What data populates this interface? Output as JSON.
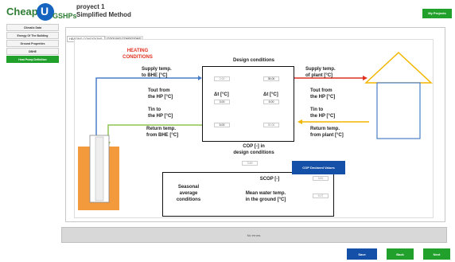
{
  "header": {
    "logo_text_left": "Cheap",
    "logo_text_right": "GSHPs",
    "project_name": "proyect 1",
    "method": "Simplified Method",
    "my_projects": "My Projects"
  },
  "sidebar": {
    "items": [
      {
        "label": "Climatic Data"
      },
      {
        "label": "Energy Of The Building"
      },
      {
        "label": "Ground Properties"
      },
      {
        "label": "DBHE"
      },
      {
        "label": "Heat Pump Definition"
      }
    ]
  },
  "tabs": [
    {
      "label": "HEATING CONDITIONS"
    },
    {
      "label": "COOLING CONDITIONS"
    }
  ],
  "diagram": {
    "heading": "HEATING\nCONDITIONS",
    "design_conditions": "Design conditions",
    "supply_bhe": "Supply temp.\nto BHE [°C]",
    "supply_plant": "Supply temp.\nof plant [°C]",
    "tout_hp_left": "Tout from\nthe HP [°C]",
    "tout_hp_right": "Tout from\nthe HP [°C]",
    "tin_hp_left": "Tin to\nthe HP [°C]",
    "tin_hp_right": "Tin to\nthe HP [°C]",
    "return_bhe": "Return temp.\nfrom BHE [°C]",
    "return_plant": "Return temp.\nfrom plant [°C]",
    "dt_left": "Δt [°C]",
    "dt_right": "Δt [°C]",
    "cop_label": "COP [-] in\ndesign conditions",
    "inputs": {
      "supply_bhe": "2.00",
      "supply_plant": "35.00",
      "dt_left": "3.00",
      "dt_right": "5.00",
      "return_bhe": "5.00",
      "return_plant": "30.00",
      "cop": "3.59"
    }
  },
  "seasonal": {
    "label": "Seasonal\naverage\nconditions",
    "scop_label": "SCOP [-]",
    "scop_value": "3.81",
    "mean_temp_label": "Mean water temp.\nin the ground [°C]",
    "mean_temp_value": "9.07"
  },
  "cop_button": "COP Declared Values",
  "status": "No errors.",
  "buttons": {
    "save": "Save",
    "back": "Back",
    "next": "Next"
  },
  "colors": {
    "accent_green": "#22a02c",
    "accent_blue": "#1550a8",
    "arrow_red": "#e03020",
    "arrow_yellow": "#f2b600",
    "arrow_green": "#8fc450",
    "arrow_blue": "#4a7ec8",
    "ground_orange": "#f29a3c"
  }
}
